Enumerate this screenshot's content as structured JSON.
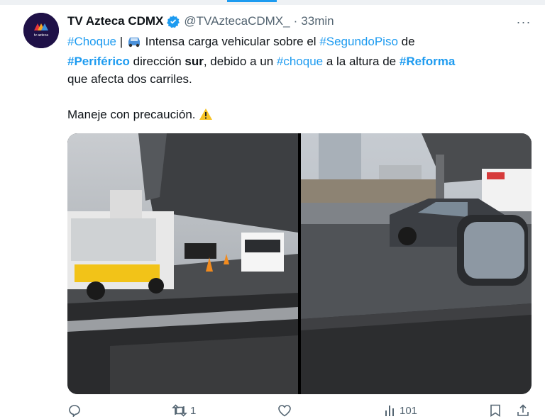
{
  "tweet": {
    "author": "TV Azteca CDMX",
    "handle": "@TVAztecaCDMX_",
    "separator": "·",
    "time": "33min",
    "avatar_text": "tv azteca",
    "more_label": "···",
    "text": {
      "l1_hash1": "#Choque",
      "l1_sep": " | ",
      "l1_body": " Intensa carga vehicular sobre el ",
      "l1_hash2": "#SegundoPiso",
      "l1_end": " de",
      "l2_hash1": "#Periférico",
      "l2_mid": " dirección ",
      "l2_bold": "sur",
      "l2_mid2": ", debido a un ",
      "l2_hash2": "#choque",
      "l2_mid3": " a la altura de ",
      "l2_hash3": "#Reforma",
      "l3": "que afecta dos carriles.",
      "l4": "Maneje con precaución. "
    },
    "emoji": {
      "car": "car-icon",
      "warning": "warning-icon"
    }
  },
  "actions": {
    "reply": {
      "icon": "reply-icon",
      "count": ""
    },
    "retweet": {
      "icon": "retweet-icon",
      "count": "1"
    },
    "like": {
      "icon": "heart-icon",
      "count": ""
    },
    "views": {
      "icon": "views-icon",
      "count": "101"
    },
    "bookmark": {
      "icon": "bookmark-icon"
    },
    "share": {
      "icon": "share-icon"
    }
  },
  "colors": {
    "link": "#1d9bf0",
    "muted": "#536471",
    "text": "#0f1419",
    "verified": "#1d9bf0"
  }
}
